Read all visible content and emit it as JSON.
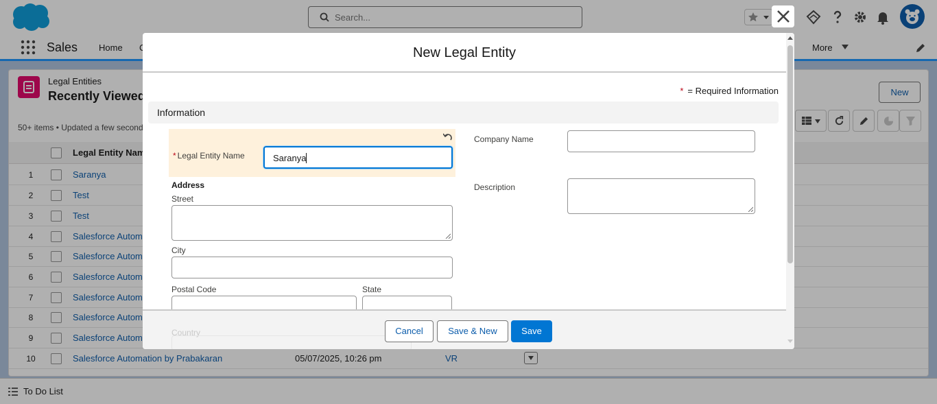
{
  "header": {
    "search_placeholder": "Search..."
  },
  "app_nav": {
    "app_name": "Sales",
    "home": "Home",
    "truncated_tab": "C",
    "more": "More"
  },
  "list_view": {
    "object_label": "Legal Entities",
    "view_name": "Recently Viewed",
    "meta": "50+ items • Updated a few second",
    "new_button": "New",
    "column_name": "Legal Entity Nam",
    "rows": [
      {
        "num": "1",
        "name": "Saranya",
        "date": "",
        "owner": ""
      },
      {
        "num": "2",
        "name": "Test",
        "date": "",
        "owner": ""
      },
      {
        "num": "3",
        "name": "Test",
        "date": "",
        "owner": ""
      },
      {
        "num": "4",
        "name": "Salesforce Automa",
        "date": "",
        "owner": ""
      },
      {
        "num": "5",
        "name": "Salesforce Automa",
        "date": "",
        "owner": ""
      },
      {
        "num": "6",
        "name": "Salesforce Automa",
        "date": "",
        "owner": ""
      },
      {
        "num": "7",
        "name": "Salesforce Automa",
        "date": "",
        "owner": ""
      },
      {
        "num": "8",
        "name": "Salesforce Automa",
        "date": "",
        "owner": ""
      },
      {
        "num": "9",
        "name": "Salesforce Automa",
        "date": "",
        "owner": ""
      },
      {
        "num": "10",
        "name": "Salesforce Automation by Prabakaran",
        "date": "05/07/2025, 10:26 pm",
        "owner": "VR"
      }
    ]
  },
  "footer": {
    "todo_label": "To Do List"
  },
  "modal": {
    "title": "New Legal Entity",
    "required_star": "*",
    "required_info": "= Required Information",
    "section_title": "Information",
    "legal_entity_name_label": "Legal Entity Name",
    "legal_entity_name_value": "Saranya",
    "company_name_label": "Company Name",
    "description_label": "Description",
    "address_title": "Address",
    "street_label": "Street",
    "city_label": "City",
    "postal_code_label": "Postal Code",
    "state_label": "State",
    "country_label": "Country",
    "cancel_button": "Cancel",
    "save_new_button": "Save & New",
    "save_button": "Save"
  },
  "colors": {
    "brand": "#0176d3",
    "link": "#0b5cab",
    "required": "#ba0517",
    "highlight": "#fef1dc"
  }
}
